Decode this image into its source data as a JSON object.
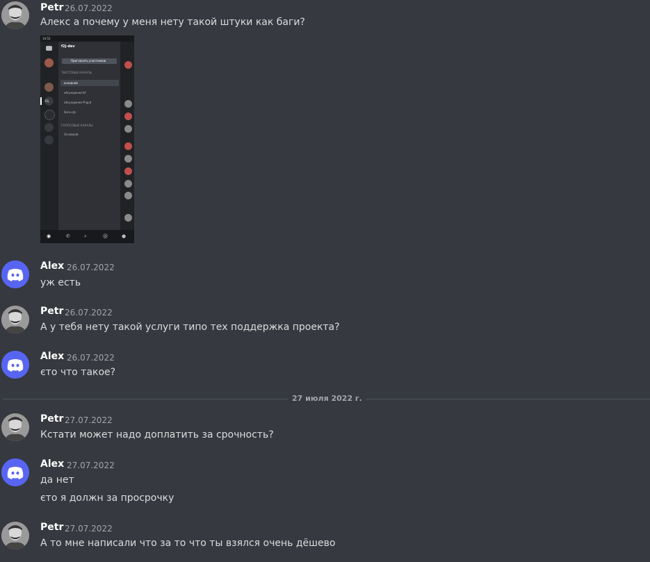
{
  "messages": [
    {
      "author": "Petr",
      "timestamp": "26.07.2022",
      "lines": [
        "Алекс а почему у меня нету такой штуки как баги?"
      ]
    },
    {
      "author": "Alex",
      "timestamp": "26.07.2022",
      "lines": [
        "уж есть"
      ]
    },
    {
      "author": "Petr",
      "timestamp": "26.07.2022",
      "lines": [
        "А у тебя нету такой услуги типо тех поддержка проекта?"
      ]
    },
    {
      "author": "Alex",
      "timestamp": "26.07.2022",
      "lines": [
        "єто что такое?"
      ]
    },
    {
      "author": "Petr",
      "timestamp": "27.07.2022",
      "lines": [
        "Кстати может надо доплатить за срочность?"
      ]
    },
    {
      "author": "Alex",
      "timestamp": "27.07.2022",
      "lines": [
        "да нет",
        "єто я должн за просрочку"
      ]
    },
    {
      "author": "Petr",
      "timestamp": "27.07.2022",
      "lines": [
        "А то мне написали что за то что ты взялся очень дёшево"
      ]
    }
  ],
  "date_divider": "27 июля 2022 г.",
  "attachment": {
    "server_name": "f2j-dev",
    "invite_button": "Пригласить участников",
    "text_channels_header": "ТЕКСТОВЫЕ КАНАЛЫ",
    "text_channels": [
      "основной",
      "обсуждение-bf",
      "обсуждение-ff-gud",
      "баги-сф"
    ],
    "voice_channels_header": "ГОЛОСОВЫЕ КАНАЛЫ",
    "voice_channels": [
      "Основной"
    ],
    "status_time": "14:53",
    "server_badge": "f2j"
  },
  "colors": {
    "background": "#36393f",
    "discord_blurple": "#5865f2",
    "username": "#ffffff",
    "timestamp": "#a3a6aa"
  }
}
